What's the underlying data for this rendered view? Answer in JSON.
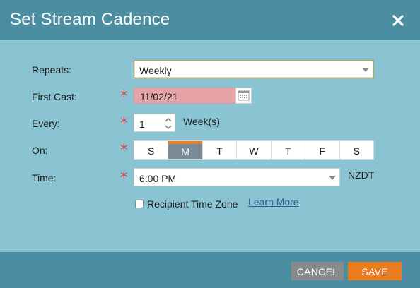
{
  "dialog": {
    "title": "Set Stream Cadence",
    "close_icon": "close-icon"
  },
  "form": {
    "repeats": {
      "label": "Repeats:",
      "value": "Weekly"
    },
    "first_cast": {
      "label": "First Cast:",
      "value": "11/02/21",
      "required_marker": "*"
    },
    "every": {
      "label": "Every:",
      "value": "1",
      "unit": "Week(s)",
      "required_marker": "*"
    },
    "on": {
      "label": "On:",
      "required_marker": "*",
      "days": [
        "S",
        "M",
        "T",
        "W",
        "T",
        "F",
        "S"
      ],
      "selected": "M"
    },
    "time": {
      "label": "Time:",
      "value": "6:00 PM",
      "timezone": "NZDT",
      "required_marker": "*"
    },
    "recipient_tz": {
      "label": "Recipient Time Zone",
      "checked": false
    },
    "learn_more": "Learn More"
  },
  "footer": {
    "cancel_label": "CANCEL",
    "save_label": "SAVE"
  },
  "colors": {
    "header": "#4b8da1",
    "body": "#8ac4d3",
    "required": "#c9464a",
    "accent": "#ea7b1e",
    "error_field": "#e6a3a6"
  }
}
